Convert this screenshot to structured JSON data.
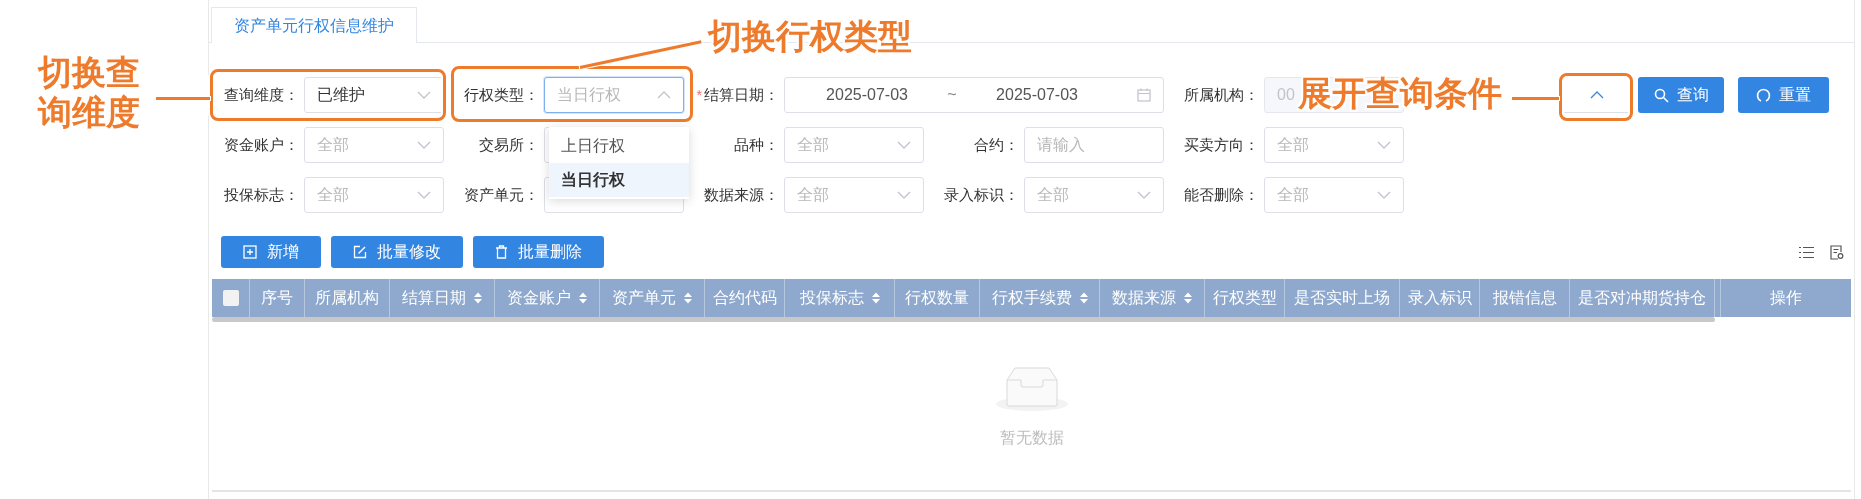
{
  "tab": {
    "label": "资产单元行权信息维护",
    "selected": true
  },
  "filters": [
    [
      {
        "kind": "select",
        "label": "查询维度：",
        "value": "已维护"
      },
      {
        "kind": "select",
        "label": "行权类型：",
        "value": "当日行权",
        "open": true,
        "options": [
          {
            "label": "上日行权",
            "selected": false
          },
          {
            "label": "当日行权",
            "selected": true
          }
        ]
      },
      {
        "kind": "date_range",
        "label": "结算日期：",
        "required_mark": "*",
        "start": "2025-07-03",
        "separator": "~",
        "end": "2025-07-03"
      },
      {
        "kind": "disabled",
        "label": "所属机构：",
        "value": "00"
      }
    ],
    [
      {
        "kind": "select",
        "label": "资金账户：",
        "placeholder": "全部"
      },
      {
        "kind": "select",
        "label": "交易所："
      },
      {
        "kind": "select",
        "label": "品种：",
        "placeholder": "全部"
      },
      {
        "kind": "input",
        "label": "合约：",
        "placeholder": "请输入"
      },
      {
        "kind": "select",
        "label": "买卖方向：",
        "placeholder": "全部"
      }
    ],
    [
      {
        "kind": "select",
        "label": "投保标志：",
        "placeholder": "全部"
      },
      {
        "kind": "select",
        "label": "资产单元："
      },
      {
        "kind": "select",
        "label": "数据来源：",
        "placeholder": "全部"
      },
      {
        "kind": "select",
        "label": "录入标识：",
        "placeholder": "全部"
      },
      {
        "kind": "select",
        "label": "能否删除：",
        "placeholder": "全部"
      }
    ]
  ],
  "query_buttons": [
    {
      "kind": "expand"
    },
    {
      "kind": "search",
      "label": "查询"
    },
    {
      "kind": "reset",
      "label": "重置"
    }
  ],
  "actions": [
    {
      "kind": "add",
      "label": "新增"
    },
    {
      "kind": "edit",
      "label": "批量修改"
    },
    {
      "kind": "delete",
      "label": "批量删除"
    }
  ],
  "table": {
    "select_all": {
      "checked": false
    },
    "columns": [
      {
        "label": "序号",
        "sortable": false
      },
      {
        "label": "所属机构",
        "sortable": false
      },
      {
        "label": "结算日期",
        "sortable": true
      },
      {
        "label": "资金账户",
        "sortable": true
      },
      {
        "label": "资产单元",
        "sortable": true
      },
      {
        "label": "合约代码",
        "sortable": false
      },
      {
        "label": "投保标志",
        "sortable": true
      },
      {
        "label": "行权数量",
        "sortable": false
      },
      {
        "label": "行权手续费",
        "sortable": true
      },
      {
        "label": "数据来源",
        "sortable": true
      },
      {
        "label": "行权类型",
        "sortable": false
      },
      {
        "label": "是否实时上场",
        "sortable": false
      },
      {
        "label": "录入标识",
        "sortable": false
      },
      {
        "label": "报错信息",
        "sortable": false
      },
      {
        "label": "是否对冲期货持仓",
        "sortable": false
      }
    ],
    "fixed_column": "操作",
    "empty_text": "暂无数据"
  },
  "annotations": [
    {
      "text": "切换查询维度"
    },
    {
      "text": "切换行权类型"
    },
    {
      "text": "展开查询条件"
    }
  ]
}
